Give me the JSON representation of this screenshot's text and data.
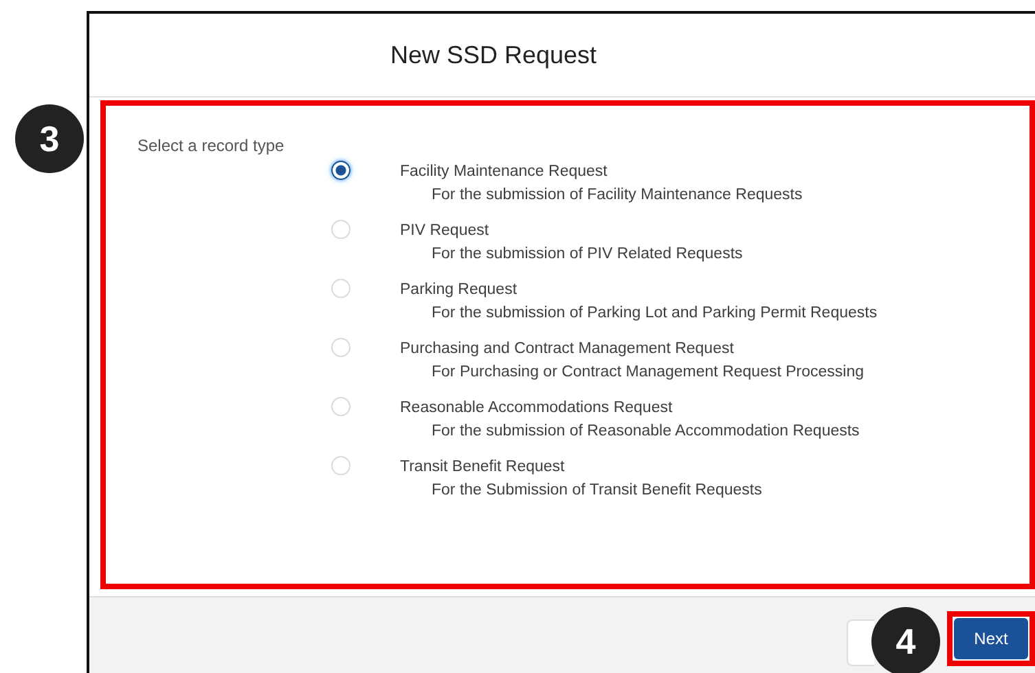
{
  "modal": {
    "title": "New SSD Request"
  },
  "record_type": {
    "label": "Select a record type",
    "options": [
      {
        "name": "Facility Maintenance Request",
        "description": "For the submission of Facility Maintenance Requests",
        "selected": true
      },
      {
        "name": "PIV Request",
        "description": "For the submission of PIV Related Requests",
        "selected": false
      },
      {
        "name": "Parking Request",
        "description": "For the submission of Parking Lot and Parking Permit Requests",
        "selected": false
      },
      {
        "name": "Purchasing and Contract Management Request",
        "description": "For Purchasing or Contract Management Request Processing",
        "selected": false
      },
      {
        "name": "Reasonable Accommodations Request",
        "description": "For the submission of Reasonable Accommodation Requests",
        "selected": false
      },
      {
        "name": "Transit Benefit Request",
        "description": "For the Submission of Transit Benefit Requests",
        "selected": false
      }
    ]
  },
  "footer": {
    "next_button": "Next"
  },
  "callouts": [
    "3",
    "4"
  ]
}
